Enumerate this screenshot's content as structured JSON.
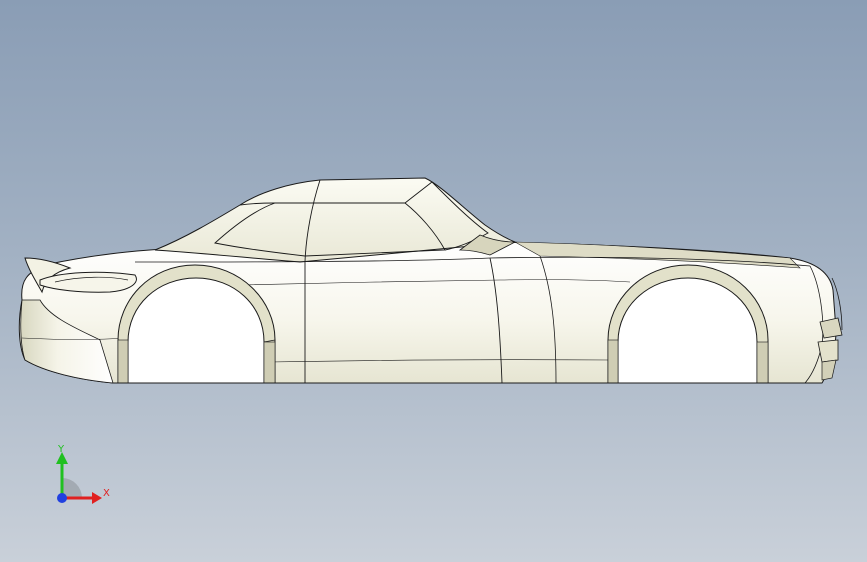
{
  "viewport": {
    "background_top": "#8a9db5",
    "background_bottom": "#c9d0d9"
  },
  "model": {
    "name": "car-body",
    "view": "side",
    "body_fill": "#f7f6ec",
    "edge_color": "#1a1a1a",
    "shade_color": "#d9d8c2"
  },
  "triad": {
    "y_label": "Y",
    "x_label": "X",
    "x_color": "#e02020",
    "y_color": "#20c020",
    "z_color": "#2040e0"
  }
}
